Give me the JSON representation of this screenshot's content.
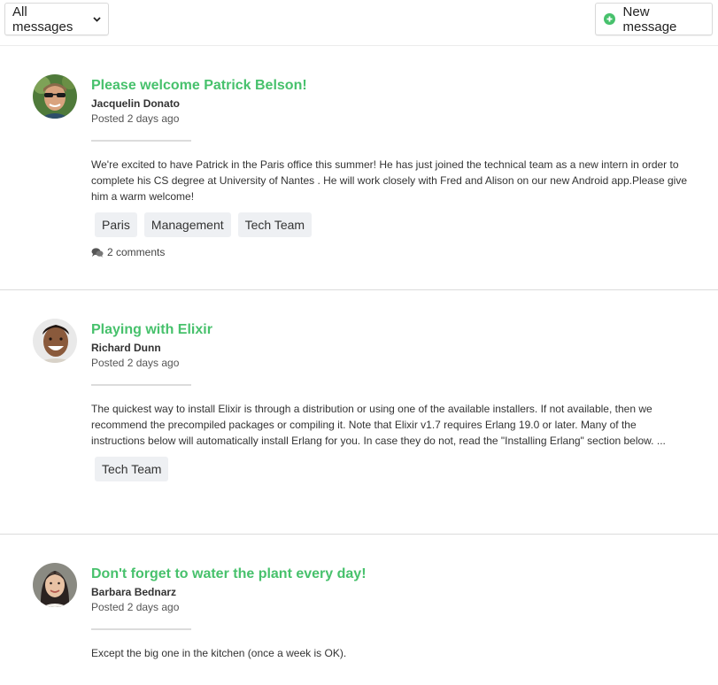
{
  "toolbar": {
    "filter_label": "All messages",
    "new_message_label": "New message"
  },
  "colors": {
    "accent": "#47c16c",
    "tag_bg": "#eef0f3"
  },
  "posts": [
    {
      "title": "Please welcome Patrick Belson!",
      "author": "Jacquelin Donato",
      "posted": "Posted 2 days ago",
      "body": "We're excited to have Patrick in the Paris office this summer! He has just joined the technical team as a new intern in order to complete his CS degree at University of Nantes . He will work closely with Fred and Alison on our new Android app.Please give him a warm welcome!",
      "tags": [
        "Paris",
        "Management",
        "Tech Team"
      ],
      "comments": "2 comments"
    },
    {
      "title": "Playing with Elixir",
      "author": "Richard Dunn",
      "posted": "Posted 2 days ago",
      "body": "The quickest way to install Elixir is through a distribution or using one of the available installers. If not available, then we recommend the precompiled packages or compiling it. Note that Elixir v1.7 requires Erlang 19.0 or later. Many of the instructions below will automatically install Erlang for you. In case they do not, read the \"Installing Erlang\" section below. ...",
      "tags": [
        "Tech Team"
      ]
    },
    {
      "title": "Don't forget to water the plant every day!",
      "author": "Barbara Bednarz",
      "posted": "Posted 2 days ago",
      "body": "Except the big one in the kitchen (once a week is OK)."
    }
  ]
}
